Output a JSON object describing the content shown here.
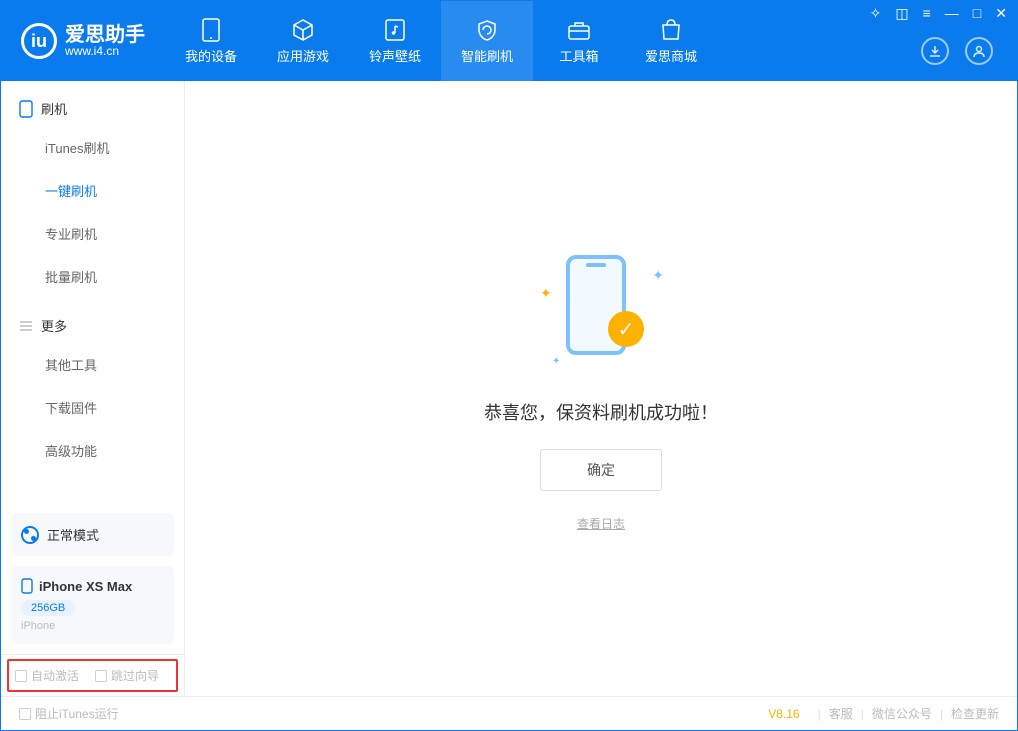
{
  "brand": {
    "name": "爱思助手",
    "url": "www.i4.cn"
  },
  "nav": {
    "device": "我的设备",
    "apps": "应用游戏",
    "ring": "铃声壁纸",
    "flash": "智能刷机",
    "toolbox": "工具箱",
    "store": "爱思商城"
  },
  "sidebar": {
    "group_flash": "刷机",
    "itunes_flash": "iTunes刷机",
    "oneclick_flash": "一键刷机",
    "pro_flash": "专业刷机",
    "batch_flash": "批量刷机",
    "group_more": "更多",
    "other_tools": "其他工具",
    "download_fw": "下载固件",
    "advanced": "高级功能"
  },
  "device": {
    "mode": "正常模式",
    "name": "iPhone XS Max",
    "capacity": "256GB",
    "type": "iPhone"
  },
  "bottom": {
    "auto_activate": "自动激活",
    "skip_guide": "跳过向导"
  },
  "main": {
    "success": "恭喜您，保资料刷机成功啦！",
    "ok": "确定",
    "view_log": "查看日志"
  },
  "footer": {
    "block_itunes": "阻止iTunes运行",
    "version": "V8.16",
    "support": "客服",
    "wechat": "微信公众号",
    "update": "检查更新"
  }
}
